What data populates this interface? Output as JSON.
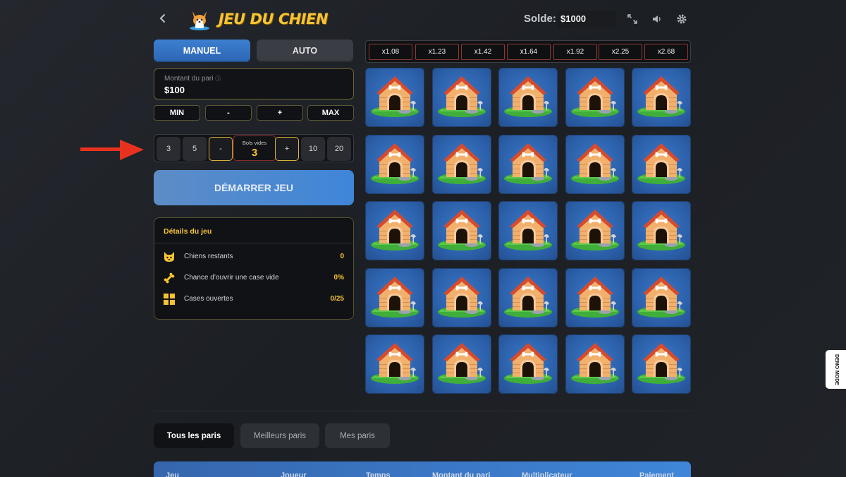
{
  "header": {
    "title": "JEU DU CHIEN",
    "balance_label": "Solde:",
    "balance_value": "$1000",
    "icons": [
      "back-arrow-icon",
      "corgi-logo-icon",
      "fullscreen-icon",
      "volume-icon",
      "settings-gear-icon"
    ]
  },
  "modes": {
    "manual": "MANUEL",
    "auto": "AUTO",
    "active": "MANUEL"
  },
  "bet": {
    "label": "Montant du pari",
    "value": "$100"
  },
  "adjust_buttons": [
    "MIN",
    "-",
    "+",
    "MAX"
  ],
  "bowls": {
    "label": "Bols vides",
    "value": "3",
    "presets_left": [
      "3",
      "5"
    ],
    "minus": "-",
    "plus": "+",
    "presets_right": [
      "10",
      "20"
    ]
  },
  "start_button": "DÉMARRER JEU",
  "details": {
    "title": "Détails du jeu",
    "rows": [
      {
        "label": "Chiens restants",
        "value": "0",
        "icon": "dog-face-icon"
      },
      {
        "label": "Chance d’ouvrir une case vide",
        "value": "0%",
        "icon": "bone-icon"
      },
      {
        "label": "Cases ouvertes",
        "value": "0/25",
        "icon": "grid-squares-icon"
      }
    ]
  },
  "multipliers": [
    "x1.08",
    "x1.23",
    "x1.42",
    "x1.64",
    "x1.92",
    "x2.25",
    "x2.68"
  ],
  "grid": {
    "rows": 5,
    "cols": 5,
    "tile_icon": "doghouse-icon"
  },
  "bet_tabs": [
    "Tous les paris",
    "Meilleurs paris",
    "Mes paris"
  ],
  "table_headers": [
    "Jeu",
    "Joueur",
    "Temps",
    "Montant du pari",
    "Multiplicateur",
    "Paiement"
  ],
  "demo_badge": "DEMO MODE",
  "colors": {
    "accent_yellow": "#f6c431",
    "accent_blue": "#3f86d9",
    "arrow_red": "#e8321f",
    "tile_blue": "#2f6ab6"
  }
}
